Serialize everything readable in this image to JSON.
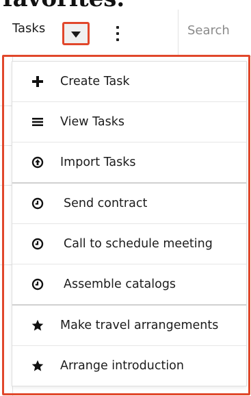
{
  "heading_cut": "favorites.",
  "nav": {
    "module_tab": "Tasks",
    "search_placeholder": "Search"
  },
  "menu": {
    "items": [
      {
        "label": "Create Task",
        "icon": "plus-icon"
      },
      {
        "label": "View Tasks",
        "icon": "list-icon"
      },
      {
        "label": "Import Tasks",
        "icon": "import-icon"
      },
      {
        "label": "Send contract",
        "icon": "clock-icon"
      },
      {
        "label": "Call to schedule meeting",
        "icon": "clock-icon"
      },
      {
        "label": "Assemble catalogs",
        "icon": "clock-icon"
      },
      {
        "label": "Make travel arrangements",
        "icon": "star-icon"
      },
      {
        "label": "Arrange introduction",
        "icon": "star-icon"
      }
    ]
  },
  "colors": {
    "highlight": "#e1472b"
  }
}
